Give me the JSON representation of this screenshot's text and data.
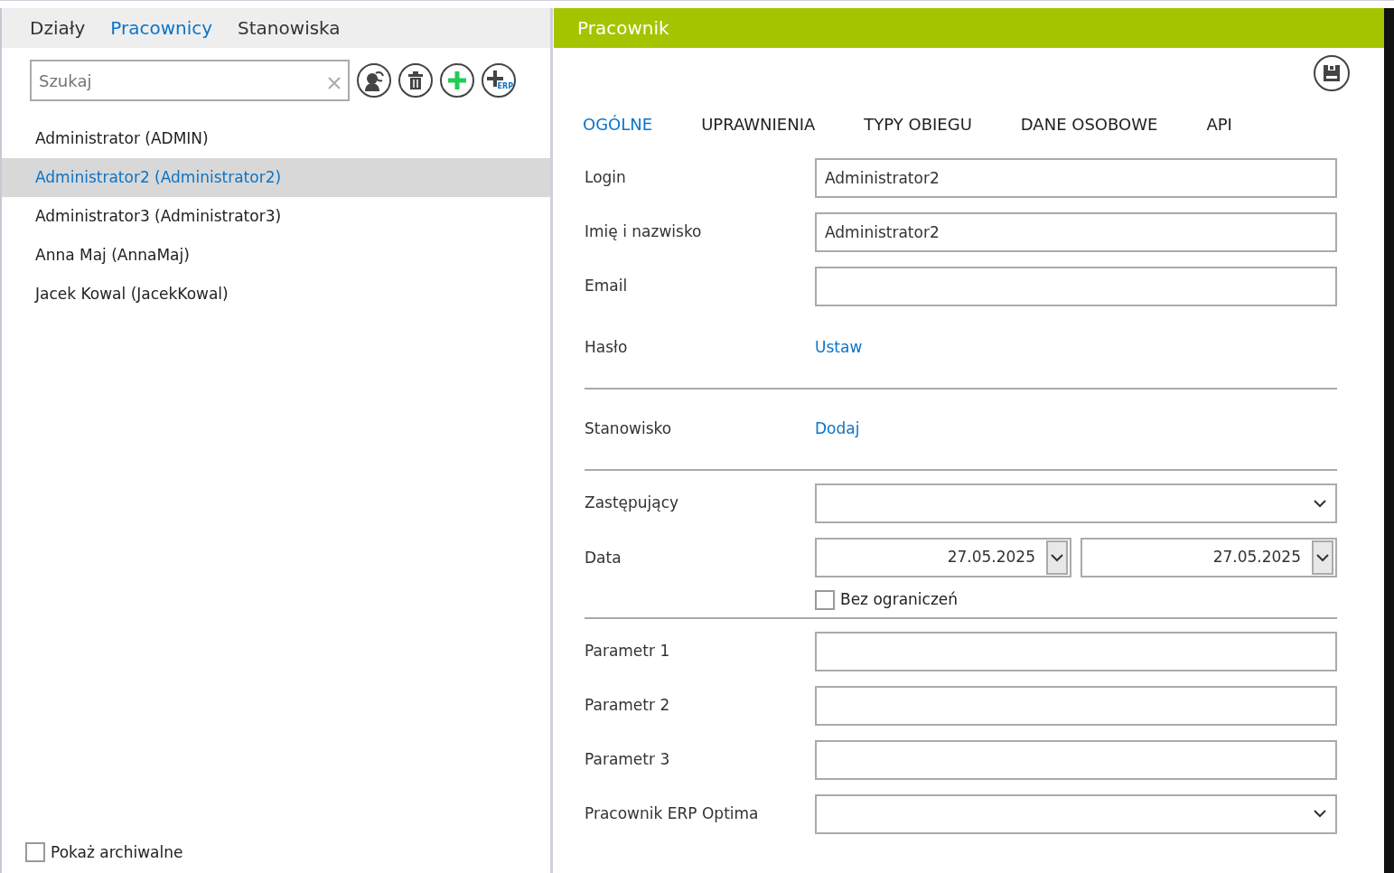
{
  "left_panel": {
    "tabs": [
      {
        "label": "Działy",
        "selected": false
      },
      {
        "label": "Pracownicy",
        "selected": true
      },
      {
        "label": "Stanowiska",
        "selected": false
      }
    ],
    "search": {
      "placeholder": "Szukaj"
    },
    "toolbar": [
      {
        "kind": "sync"
      },
      {
        "kind": "delete"
      },
      {
        "kind": "add"
      },
      {
        "kind": "add-erp",
        "label": "ERP"
      }
    ],
    "employees": [
      {
        "label": "Administrator (ADMIN)",
        "selected": false
      },
      {
        "label": "Administrator2 (Administrator2)",
        "selected": true
      },
      {
        "label": "Administrator3 (Administrator3)",
        "selected": false
      },
      {
        "label": "Anna Maj (AnnaMaj)",
        "selected": false
      },
      {
        "label": "Jacek Kowal (JacekKowal)",
        "selected": false
      }
    ],
    "show_archived": {
      "label": "Pokaż archiwalne",
      "checked": false
    }
  },
  "right_panel": {
    "title": "Pracownik",
    "tabs": [
      {
        "label": "OGÓLNE",
        "selected": true
      },
      {
        "label": "UPRAWNIENIA",
        "selected": false
      },
      {
        "label": "TYPY OBIEGU",
        "selected": false
      },
      {
        "label": "DANE OSOBOWE",
        "selected": false
      },
      {
        "label": "API",
        "selected": false
      }
    ],
    "fields": [
      {
        "kind": "text",
        "label": "Login",
        "value": "Administrator2"
      },
      {
        "kind": "text",
        "label": "Imię i nazwisko",
        "value": "Administrator2"
      },
      {
        "kind": "text",
        "label": "Email"
      },
      {
        "kind": "link",
        "label": "Hasło",
        "link": "Ustaw"
      },
      {
        "kind": "separator"
      },
      {
        "kind": "link",
        "label": "Stanowisko",
        "link": "Dodaj"
      },
      {
        "kind": "separator"
      },
      {
        "kind": "select",
        "label": "Zastępujący"
      },
      {
        "kind": "daterange",
        "label": "Data",
        "from": "27.05.2025",
        "to": "27.05.2025",
        "checkbox": {
          "label": "Bez ograniczeń",
          "checked": false
        }
      },
      {
        "kind": "separator"
      },
      {
        "kind": "text",
        "label": "Parametr 1"
      },
      {
        "kind": "text",
        "label": "Parametr 2"
      },
      {
        "kind": "text",
        "label": "Parametr 3"
      },
      {
        "kind": "select",
        "label": "Pracownik ERP Optima"
      }
    ]
  }
}
